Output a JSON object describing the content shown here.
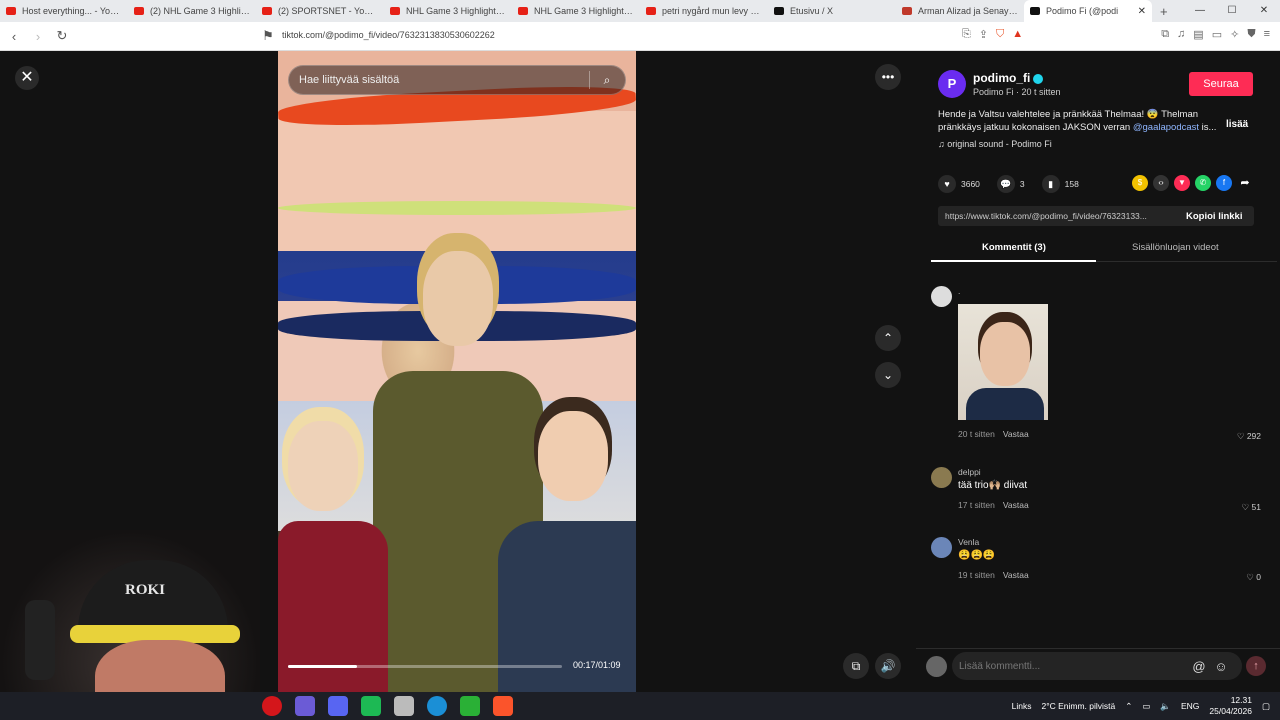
{
  "browser": {
    "tabs": [
      {
        "title": "Host everything... - YouTub",
        "fav": "#e62117",
        "active": false
      },
      {
        "title": "(2) NHL Game 3 Highlight...",
        "fav": "#e62117",
        "active": false
      },
      {
        "title": "(2) SPORTSNET - YouTube",
        "fav": "#e62117",
        "active": false
      },
      {
        "title": "NHL Game 3 Highlights |...",
        "fav": "#e62117",
        "active": false
      },
      {
        "title": "NHL Game 3 Highlights |...",
        "fav": "#e62117",
        "active": false
      },
      {
        "title": "petri nygård mun levy - Yo",
        "fav": "#e62117",
        "active": false
      },
      {
        "title": "Etusivu / X",
        "fav": "#111111",
        "active": false
      },
      {
        "title": "Arman Alizad ja Senay Co",
        "fav": "#c0392b",
        "active": false
      },
      {
        "title": "Podimo Fi (@podi",
        "fav": "#111111",
        "active": true
      }
    ],
    "url": "tiktok.com/@podimo_fi/video/7632313830530602262",
    "new_tab_label": "+",
    "window_controls": {
      "minimize": "—",
      "maximize": "☐",
      "close": "✕"
    }
  },
  "video": {
    "search_placeholder": "Hae liittyvää sisältöä",
    "timecode": "00:17/01:09",
    "progress": 0.25
  },
  "post": {
    "username": "podimo_fi",
    "avatar_letter": "P",
    "subtitle": "Podimo Fi · 20 t sitten",
    "follow_label": "Seuraa",
    "description": "Hende ja Valtsu valehtelee ja pränkkää Thelmaa! 😨 Thelman pränkkäys jatkuu kokonaisen JAKSON verran",
    "mention": "@gaalapodcast",
    "description_end": " is...",
    "more_label": "lisää",
    "sound": "♫  original sound - Podimo Fi",
    "likes": "3660",
    "comments": "3",
    "saves": "158",
    "link": "https://www.tiktok.com/@podimo_fi/video/76323133...",
    "copy_label": "Kopioi linkki",
    "tab_comments": "Kommentit (3)",
    "tab_creator": "Sisällönluojan videot"
  },
  "comments": [
    {
      "name": ".",
      "text": "",
      "time": "20 t sitten",
      "reply": "Vastaa",
      "likes": "292",
      "color": "#dddddd"
    },
    {
      "name": "delppi",
      "text": "tää trio🙌🏼 diivat",
      "time": "17 t sitten",
      "reply": "Vastaa",
      "likes": "51",
      "color": "#8a7a50"
    },
    {
      "name": "Venla",
      "text": "😩😩😩",
      "time": "19 t sitten",
      "reply": "Vastaa",
      "likes": "0",
      "color": "#6b86b8"
    }
  ],
  "composer": {
    "placeholder": "Lisää kommentti..."
  },
  "webcam": {
    "cap_logo": "ROKI"
  },
  "taskbar": {
    "links": "Links",
    "weather": "2°C  Enimm. pilvistä",
    "lang": "ENG",
    "time": "12.31",
    "date": "25/04/2026"
  }
}
